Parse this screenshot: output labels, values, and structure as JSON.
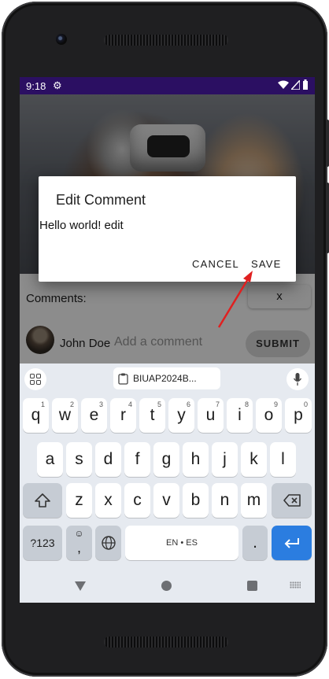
{
  "status_bar": {
    "time": "9:18"
  },
  "screen": {
    "comments_label": "Comments:",
    "close_button_label": "x",
    "user_name": "John Doe",
    "comment_placeholder": "Add a comment",
    "submit_label": "SUBMIT"
  },
  "dialog": {
    "title": "Edit Comment",
    "input_value": "Hello world! edit",
    "cancel_label": "CANCEL",
    "save_label": "SAVE"
  },
  "annotation": {
    "arrow_color": "#e02020",
    "target": "dialog.save_label"
  },
  "keyboard": {
    "clipboard_text": "BIUAP2024B...",
    "row1": [
      {
        "label": "q",
        "hint": "1"
      },
      {
        "label": "w",
        "hint": "2"
      },
      {
        "label": "e",
        "hint": "3"
      },
      {
        "label": "r",
        "hint": "4"
      },
      {
        "label": "t",
        "hint": "5"
      },
      {
        "label": "y",
        "hint": "6"
      },
      {
        "label": "u",
        "hint": "7"
      },
      {
        "label": "i",
        "hint": "8"
      },
      {
        "label": "o",
        "hint": "9"
      },
      {
        "label": "p",
        "hint": "0"
      }
    ],
    "row2": [
      "a",
      "s",
      "d",
      "f",
      "g",
      "h",
      "j",
      "k",
      "l"
    ],
    "row3": [
      "z",
      "x",
      "c",
      "v",
      "b",
      "n",
      "m"
    ],
    "symbols_label": "?123",
    "comma_label": ",",
    "space_label": "EN • ES",
    "period_label": ".",
    "emoji_glyph": "☺",
    "icons": [
      "apps-grid-icon",
      "clipboard-icon",
      "microphone-icon",
      "shift-icon",
      "backspace-icon",
      "globe-icon",
      "enter-icon"
    ]
  },
  "colors": {
    "status_bar": "#2b0f62",
    "enter_key": "#2b7de0",
    "keyboard_bg": "#e6eaf0"
  }
}
